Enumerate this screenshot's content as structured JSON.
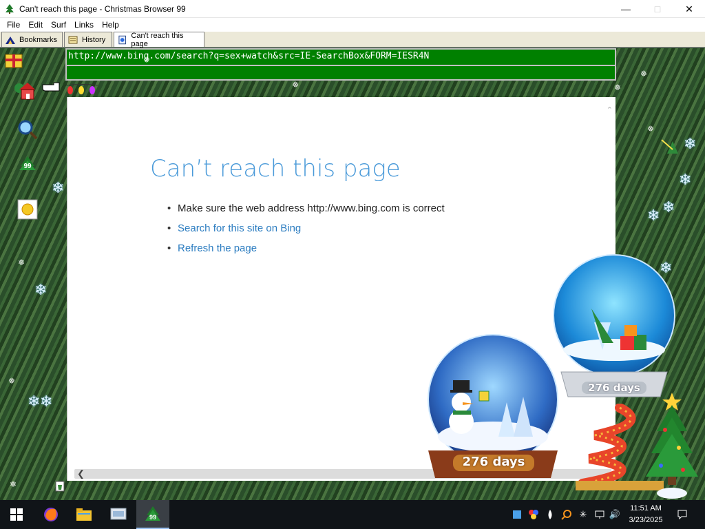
{
  "window": {
    "title": "Can't reach this page - Christmas Browser 99"
  },
  "menubar": {
    "items": [
      "File",
      "Edit",
      "Surf",
      "Links",
      "Help"
    ]
  },
  "tabs": [
    {
      "label": "Bookmarks"
    },
    {
      "label": "History"
    },
    {
      "label": "Can't reach this page",
      "active": true
    }
  ],
  "address": {
    "url": "http://www.bing.com/search?q=sex+watch&src=IE-SearchBox&FORM=IESR4N"
  },
  "sidebar": {
    "tree_badge": "99"
  },
  "page": {
    "title": "Can’t reach this page",
    "items": [
      "Make sure the web address http://www.bing.com is correct",
      "Search for this site on Bing",
      "Refresh the page"
    ]
  },
  "countdown": {
    "globe1": "276 days",
    "globe2": "276 days"
  },
  "taskbar": {
    "active_badge": "99",
    "clock_time": "11:51 AM",
    "clock_date": "3/23/2025"
  },
  "colors": {
    "address_bg": "#008000",
    "link": "#2b7cc0",
    "title": "#4a9ad9",
    "taskbar": "#101418"
  }
}
